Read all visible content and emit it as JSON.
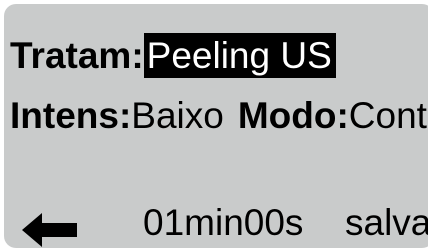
{
  "treatment": {
    "label": "Tratam:",
    "value": "Peeling US"
  },
  "intensity": {
    "label": "Intens:",
    "value": "Baixo"
  },
  "mode": {
    "label": "Modo:",
    "value": "Cont"
  },
  "footer": {
    "back_icon": "left-arrow-icon",
    "time": "01min00s",
    "save_label": "salvar"
  },
  "colors": {
    "screen_background": "#c9cbcb",
    "highlight_background": "#000000",
    "highlight_text": "#ffffff"
  }
}
